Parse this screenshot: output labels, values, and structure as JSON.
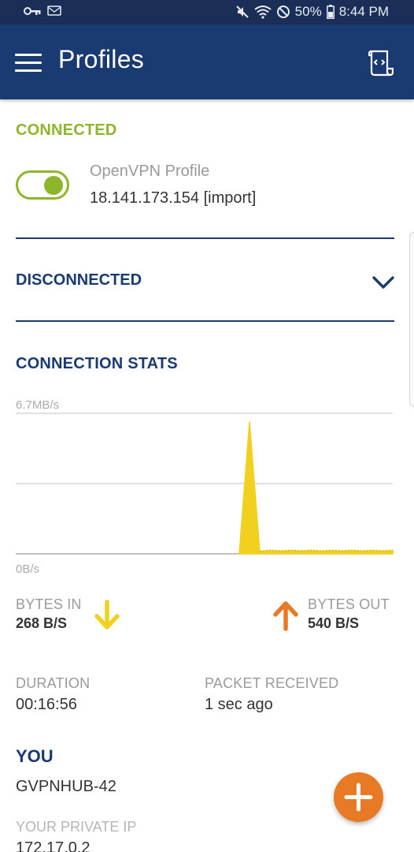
{
  "status_bar": {
    "battery": "50%",
    "time": "8:44 PM"
  },
  "app_bar": {
    "title": "Profiles"
  },
  "connected": {
    "section_label": "CONNECTED",
    "profile_name": "OpenVPN Profile",
    "profile_host": "18.141.173.154 [import]",
    "toggle_on": true
  },
  "disconnected": {
    "section_label": "DISCONNECTED"
  },
  "stats": {
    "section_label": "CONNECTION STATS",
    "bytes_in_label": "BYTES IN",
    "bytes_in_value": "268 B/S",
    "bytes_out_label": "BYTES OUT",
    "bytes_out_value": "540 B/S",
    "duration_label": "DURATION",
    "duration_value": "00:16:56",
    "packet_label": "PACKET RECEIVED",
    "packet_value": "1 sec ago"
  },
  "you": {
    "section_label": "YOU",
    "hostname": "GVPNHUB-42",
    "private_ip_label": "YOUR PRIVATE IP",
    "private_ip_value": "172.17.0.2"
  },
  "colors": {
    "header": "#1a3a72",
    "status_bar": "#1a2e58",
    "connected_green": "#8db62a",
    "traffic_yellow": "#f2d01e",
    "bytes_out_orange": "#e97a25",
    "fab_orange": "#e97a25"
  },
  "chart_data": {
    "type": "area",
    "ytick_labels": [
      "6.7MB/s",
      "0B/s"
    ],
    "ylim": [
      0,
      6.7
    ],
    "x": [
      0,
      1,
      2,
      3,
      4,
      5,
      6,
      7,
      8,
      9,
      10,
      11,
      12,
      13,
      14,
      15,
      16,
      17,
      18,
      19,
      20,
      21,
      22,
      23,
      24,
      25,
      26,
      27,
      28,
      29,
      30,
      31,
      32,
      33,
      34,
      35,
      36,
      37,
      38,
      39,
      40
    ],
    "series": [
      {
        "color": "#f2d01e",
        "values": [
          0,
          0,
          0,
          0,
          0,
          0,
          0,
          0,
          0,
          0,
          0,
          0,
          0,
          0,
          0,
          0,
          0,
          0,
          0,
          0,
          0,
          0,
          0,
          0,
          0,
          0,
          6.3,
          0.1,
          0.15,
          0.12,
          0.15,
          0.12,
          0.15,
          0.12,
          0.15,
          0.12,
          0.15,
          0.12,
          0.15,
          0.12,
          0.15
        ]
      }
    ],
    "grid": true
  },
  "icons": {
    "menu": "menu-icon",
    "log": "log-file-icon",
    "chevron": "chevron-down-icon",
    "bytes_in": "arrow-down-icon",
    "bytes_out": "arrow-up-icon",
    "fab": "plus-icon"
  }
}
